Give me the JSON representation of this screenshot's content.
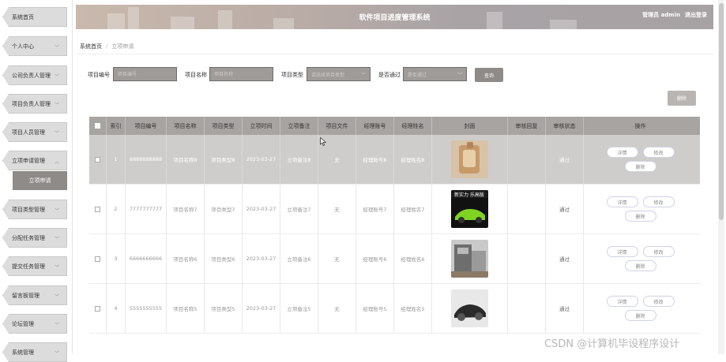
{
  "app_title": "软件项目进度管理系统",
  "header": {
    "user": "管理员 admin",
    "logout": "退出登录"
  },
  "sidebar": {
    "items": [
      {
        "label": "系统首页"
      },
      {
        "label": "个人中心",
        "chevron": "chevron-down-icon"
      },
      {
        "label": "公司负责人管理",
        "chevron": "chevron-down-icon"
      },
      {
        "label": "项目负责人管理",
        "chevron": "chevron-down-icon"
      },
      {
        "label": "项目人员管理",
        "chevron": "chevron-down-icon"
      },
      {
        "label": "立项申请管理",
        "chevron": "chevron-up-icon"
      },
      {
        "label": "项目类型管理",
        "chevron": "chevron-down-icon"
      },
      {
        "label": "分配任务管理",
        "chevron": "chevron-down-icon"
      },
      {
        "label": "提交任务管理",
        "chevron": "chevron-down-icon"
      },
      {
        "label": "留言板管理",
        "chevron": "chevron-down-icon"
      },
      {
        "label": "论坛管理",
        "chevron": "chevron-down-icon"
      },
      {
        "label": "系统管理",
        "chevron": "chevron-down-icon"
      }
    ],
    "subitem": "立项申请"
  },
  "breadcrumb": {
    "home": "系统首页",
    "current": "立项申请"
  },
  "search": {
    "fields": [
      {
        "label": "项目编号",
        "placeholder": "项目编号"
      },
      {
        "label": "项目名称",
        "placeholder": "项目名称"
      },
      {
        "label": "项目类型",
        "placeholder": "请选择项目类型"
      },
      {
        "label": "是否通过",
        "placeholder": "是否通过"
      }
    ],
    "button": "查询"
  },
  "delete_button": "删除",
  "table": {
    "headers": [
      "",
      "索引",
      "项目编号",
      "项目名称",
      "项目类型",
      "立项时间",
      "立项备注",
      "项目文件",
      "经理账号",
      "经理姓名",
      "封面",
      "审核回复",
      "审核状态",
      "操作"
    ],
    "rows": [
      {
        "index": "1",
        "code": "8888888888",
        "name": "项目名称8",
        "type": "项目类型8",
        "date": "2023-03-27",
        "note": "立项备注8",
        "file": "无",
        "account": "经理账号8",
        "manager": "经理姓名8",
        "reply": "",
        "status": "通过",
        "cover": "wood-craft"
      },
      {
        "index": "2",
        "code": "7777777777",
        "name": "项目名称7",
        "type": "项目类型7",
        "date": "2023-03-27",
        "note": "立项备注7",
        "file": "无",
        "account": "经理账号7",
        "manager": "经理姓名7",
        "reply": "",
        "status": "通过",
        "cover": "green-car"
      },
      {
        "index": "3",
        "code": "6666666666",
        "name": "项目名称6",
        "type": "项目类型6",
        "date": "2023-03-27",
        "note": "立项备注6",
        "file": "无",
        "account": "经理账号6",
        "manager": "经理姓名6",
        "reply": "",
        "status": "通过",
        "cover": "machine"
      },
      {
        "index": "4",
        "code": "5555555555",
        "name": "项目名称5",
        "type": "项目类型5",
        "date": "2023-03-27",
        "note": "立项备注5",
        "file": "无",
        "account": "经理账号5",
        "manager": "经理姓名5",
        "reply": "",
        "status": "通过",
        "cover": "black-car"
      }
    ],
    "row_actions": {
      "detail": "详情",
      "edit": "修改",
      "delete": "删除"
    },
    "cover_banner": "新实力 乐高版"
  },
  "watermark": "CSDN @计算机毕设程序设计",
  "colors": {
    "header": "#b9aca6",
    "button": "#8e8b88",
    "selected_row": "#cfcdcb",
    "table_header": "#a7a4a2"
  }
}
